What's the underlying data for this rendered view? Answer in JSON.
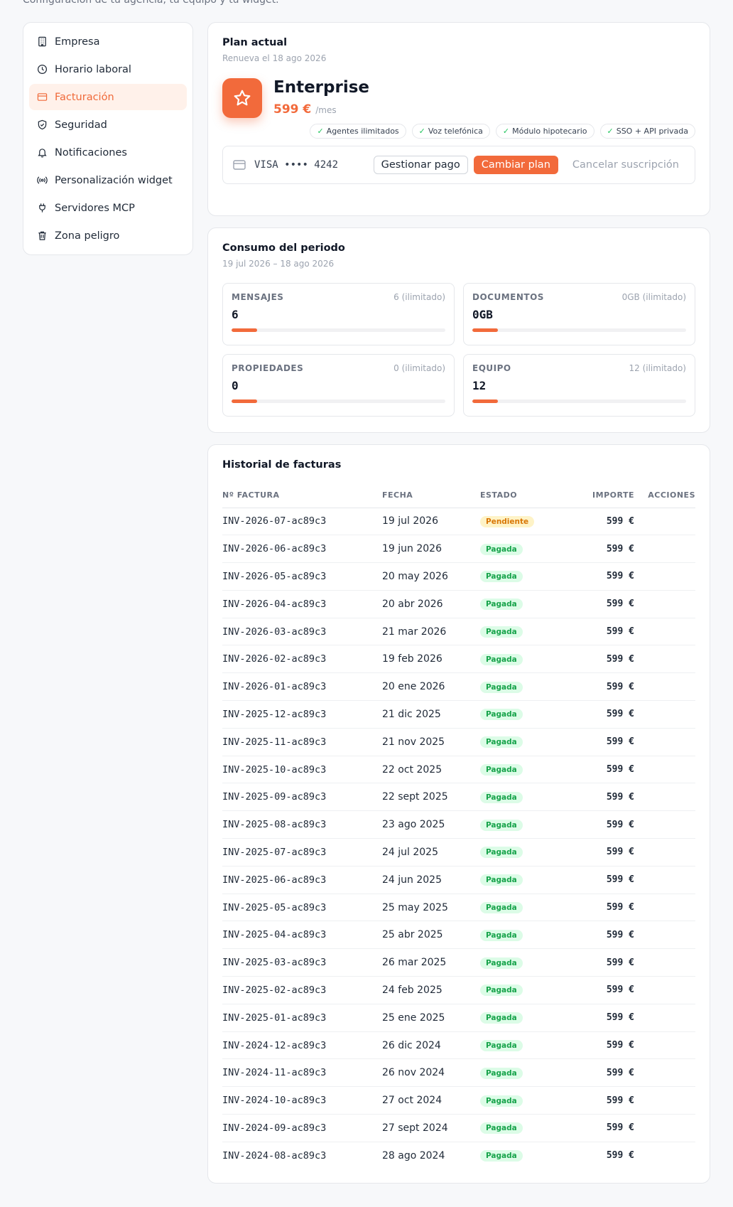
{
  "page": {
    "subtitle": "Configuración de tu agencia, tu equipo y tu widget."
  },
  "sidebar": {
    "items": [
      {
        "label": "Empresa",
        "icon": "building-icon",
        "active": false
      },
      {
        "label": "Horario laboral",
        "icon": "clock-icon",
        "active": false
      },
      {
        "label": "Facturación",
        "icon": "credit-card-icon",
        "active": true
      },
      {
        "label": "Seguridad",
        "icon": "shield-icon",
        "active": false
      },
      {
        "label": "Notificaciones",
        "icon": "bell-icon",
        "active": false
      },
      {
        "label": "Personalización widget",
        "icon": "broadcast-icon",
        "active": false
      },
      {
        "label": "Servidores MCP",
        "icon": "plug-icon",
        "active": false
      },
      {
        "label": "Zona peligro",
        "icon": "trash-icon",
        "active": false
      }
    ]
  },
  "plan": {
    "title": "Plan actual",
    "renewal": "Renueva el 18 ago 2026",
    "name": "Enterprise",
    "price": "599 €",
    "period": "/mes",
    "features": [
      "Agentes ilimitados",
      "Voz telefónica",
      "Módulo hipotecario",
      "SSO + API privada"
    ],
    "card_brand": "VISA",
    "card_number": "•••• 4242",
    "manage_label": "Gestionar pago",
    "change_label": "Cambiar plan",
    "cancel_label": "Cancelar suscripción",
    "accent": "#f26a3b"
  },
  "usage": {
    "title": "Consumo del periodo",
    "period": "19 jul 2026 – 18 ago 2026",
    "metrics": [
      {
        "label": "MENSAJES",
        "limit": "6 (ilimitado)",
        "value": "6",
        "fill": 0.12
      },
      {
        "label": "DOCUMENTOS",
        "limit": "0GB (ilimitado)",
        "value": "0GB",
        "fill": 0.12
      },
      {
        "label": "PROPIEDADES",
        "limit": "0 (ilimitado)",
        "value": "0",
        "fill": 0.12
      },
      {
        "label": "EQUIPO",
        "limit": "12 (ilimitado)",
        "value": "12",
        "fill": 0.12
      }
    ]
  },
  "invoices": {
    "title": "Historial de facturas",
    "columns": [
      "Nº FACTURA",
      "FECHA",
      "ESTADO",
      "IMPORTE",
      "ACCIONES"
    ],
    "rows": [
      {
        "id": "INV-2026-07-ac89c3",
        "date": "19 jul 2026",
        "status": "Pendiente",
        "status_type": "pending",
        "amount": "599 €"
      },
      {
        "id": "INV-2026-06-ac89c3",
        "date": "19 jun 2026",
        "status": "Pagada",
        "status_type": "paid",
        "amount": "599 €"
      },
      {
        "id": "INV-2026-05-ac89c3",
        "date": "20 may 2026",
        "status": "Pagada",
        "status_type": "paid",
        "amount": "599 €"
      },
      {
        "id": "INV-2026-04-ac89c3",
        "date": "20 abr 2026",
        "status": "Pagada",
        "status_type": "paid",
        "amount": "599 €"
      },
      {
        "id": "INV-2026-03-ac89c3",
        "date": "21 mar 2026",
        "status": "Pagada",
        "status_type": "paid",
        "amount": "599 €"
      },
      {
        "id": "INV-2026-02-ac89c3",
        "date": "19 feb 2026",
        "status": "Pagada",
        "status_type": "paid",
        "amount": "599 €"
      },
      {
        "id": "INV-2026-01-ac89c3",
        "date": "20 ene 2026",
        "status": "Pagada",
        "status_type": "paid",
        "amount": "599 €"
      },
      {
        "id": "INV-2025-12-ac89c3",
        "date": "21 dic 2025",
        "status": "Pagada",
        "status_type": "paid",
        "amount": "599 €"
      },
      {
        "id": "INV-2025-11-ac89c3",
        "date": "21 nov 2025",
        "status": "Pagada",
        "status_type": "paid",
        "amount": "599 €"
      },
      {
        "id": "INV-2025-10-ac89c3",
        "date": "22 oct 2025",
        "status": "Pagada",
        "status_type": "paid",
        "amount": "599 €"
      },
      {
        "id": "INV-2025-09-ac89c3",
        "date": "22 sept 2025",
        "status": "Pagada",
        "status_type": "paid",
        "amount": "599 €"
      },
      {
        "id": "INV-2025-08-ac89c3",
        "date": "23 ago 2025",
        "status": "Pagada",
        "status_type": "paid",
        "amount": "599 €"
      },
      {
        "id": "INV-2025-07-ac89c3",
        "date": "24 jul 2025",
        "status": "Pagada",
        "status_type": "paid",
        "amount": "599 €"
      },
      {
        "id": "INV-2025-06-ac89c3",
        "date": "24 jun 2025",
        "status": "Pagada",
        "status_type": "paid",
        "amount": "599 €"
      },
      {
        "id": "INV-2025-05-ac89c3",
        "date": "25 may 2025",
        "status": "Pagada",
        "status_type": "paid",
        "amount": "599 €"
      },
      {
        "id": "INV-2025-04-ac89c3",
        "date": "25 abr 2025",
        "status": "Pagada",
        "status_type": "paid",
        "amount": "599 €"
      },
      {
        "id": "INV-2025-03-ac89c3",
        "date": "26 mar 2025",
        "status": "Pagada",
        "status_type": "paid",
        "amount": "599 €"
      },
      {
        "id": "INV-2025-02-ac89c3",
        "date": "24 feb 2025",
        "status": "Pagada",
        "status_type": "paid",
        "amount": "599 €"
      },
      {
        "id": "INV-2025-01-ac89c3",
        "date": "25 ene 2025",
        "status": "Pagada",
        "status_type": "paid",
        "amount": "599 €"
      },
      {
        "id": "INV-2024-12-ac89c3",
        "date": "26 dic 2024",
        "status": "Pagada",
        "status_type": "paid",
        "amount": "599 €"
      },
      {
        "id": "INV-2024-11-ac89c3",
        "date": "26 nov 2024",
        "status": "Pagada",
        "status_type": "paid",
        "amount": "599 €"
      },
      {
        "id": "INV-2024-10-ac89c3",
        "date": "27 oct 2024",
        "status": "Pagada",
        "status_type": "paid",
        "amount": "599 €"
      },
      {
        "id": "INV-2024-09-ac89c3",
        "date": "27 sept 2024",
        "status": "Pagada",
        "status_type": "paid",
        "amount": "599 €"
      },
      {
        "id": "INV-2024-08-ac89c3",
        "date": "28 ago 2024",
        "status": "Pagada",
        "status_type": "paid",
        "amount": "599 €"
      }
    ]
  }
}
